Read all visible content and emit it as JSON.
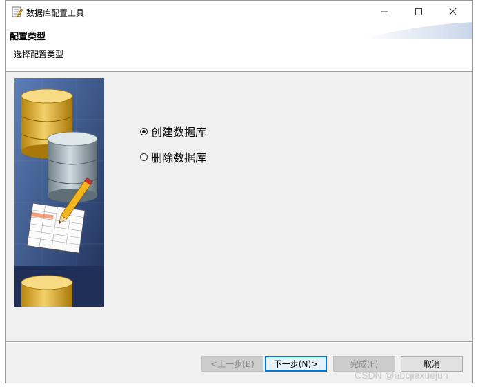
{
  "window": {
    "title": "数据库配置工具",
    "controls": {
      "minimize": "minimize-icon",
      "maximize": "maximize-icon",
      "close": "close-icon"
    }
  },
  "header": {
    "title": "配置类型",
    "subtitle": "选择配置类型"
  },
  "options": [
    {
      "label": "创建数据库",
      "selected": true
    },
    {
      "label": "删除数据库",
      "selected": false
    }
  ],
  "footer": {
    "back_label": "<上一步(B)",
    "next_label": "下一步(N)>",
    "finish_label": "完成(F)",
    "cancel_label": "取消"
  },
  "watermark": "CSDN @abcjiaxuejun",
  "colors": {
    "accent": "#0078d7",
    "image_background": "#2d3f6e"
  }
}
